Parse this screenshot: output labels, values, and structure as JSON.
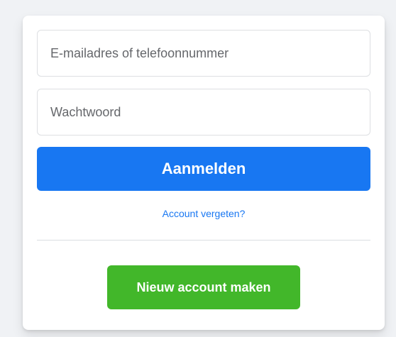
{
  "login_form": {
    "email_placeholder": "E-mailadres of telefoonnummer",
    "email_value": "",
    "password_placeholder": "Wachtwoord",
    "password_value": "",
    "login_button_label": "Aanmelden",
    "forgot_link_label": "Account vergeten?",
    "create_account_button_label": "Nieuw account maken"
  },
  "colors": {
    "page_background": "#f0f2f5",
    "primary_blue": "#1877f2",
    "success_green": "#42b72a",
    "divider": "#dadde1",
    "input_border": "#dddfe2"
  }
}
